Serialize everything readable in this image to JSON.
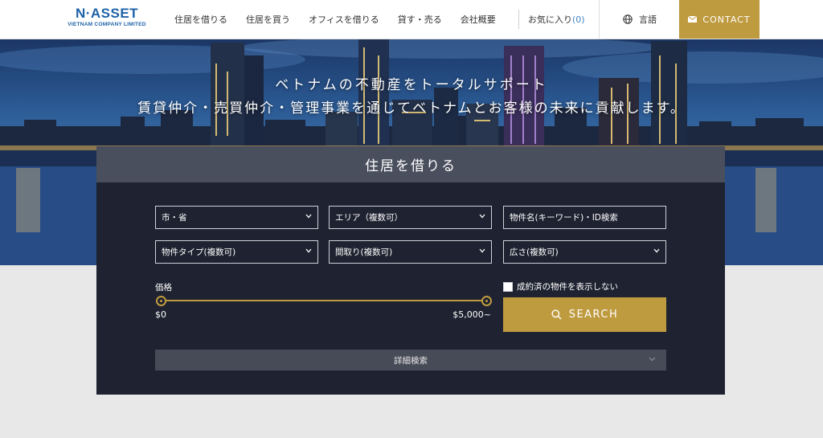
{
  "logo": {
    "main": "N·ASSET",
    "sub": "VIETNAM COMPANY LIMITED"
  },
  "nav": {
    "items": [
      "住居を借りる",
      "住居を買う",
      "オフィスを借りる",
      "貸す・売る",
      "会社概要"
    ],
    "favorites_label": "お気に入り",
    "favorites_count": "(0)",
    "language_label": "言語",
    "contact_label": "CONTACT"
  },
  "hero": {
    "line1": "ベトナムの不動産をトータルサポート",
    "line2": "賃貸仲介・売買仲介・管理事業を通じてベトナムとお客様の未来に貢献します。"
  },
  "search": {
    "title": "住居を借りる",
    "city_select": "市・省",
    "area_select": "エリア（複数可）",
    "keyword_placeholder": "物件名(キーワード)・ID検索",
    "type_select": "物件タイプ(複数可)",
    "layout_select": "間取り(複数可)",
    "size_select": "広さ(複数可)",
    "price_label": "価格",
    "price_min": "$0",
    "price_max": "$5,000~",
    "price_range_fraction": [
      0,
      1
    ],
    "hide_contracted_label": "成約済の物件を表示しない",
    "hide_contracted_checked": false,
    "search_button": "SEARCH",
    "advanced_label": "詳細検索"
  },
  "colors": {
    "brand_blue": "#1d62a8",
    "accent_gold": "#bf9b40",
    "panel_bg": "#1f2230",
    "panel_header": "#4a4f5e",
    "favorites_count": "#3f88c8"
  }
}
